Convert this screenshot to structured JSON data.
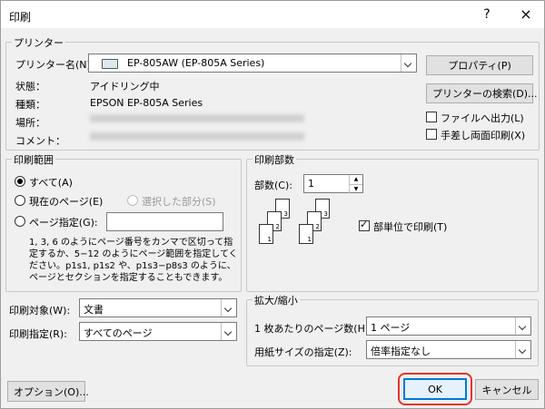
{
  "window": {
    "title": "印刷",
    "help": "?",
    "close": "×"
  },
  "printer": {
    "group_label": "プリンター",
    "name_label": "プリンター名(N):",
    "name_value": "EP-805AW (EP-805A Series)",
    "status_label": "状態：",
    "status_value": "アイドリング中",
    "type_label": "種類：",
    "type_value": "EPSON EP-805A Series",
    "location_label": "場所：",
    "comment_label": "コメント：",
    "properties_button": "プロパティ(P)",
    "find_button": "プリンターの検索(D)...",
    "print_to_file": "ファイルへ出力(L)",
    "manual_duplex": "手差し両面印刷(X)"
  },
  "range": {
    "group_label": "印刷範囲",
    "all": "すべて(A)",
    "current": "現在のページ(E)",
    "selection": "選択した部分(S)",
    "pages": "ページ指定(G):",
    "pages_value": "",
    "help_lines": [
      "1, 3, 6 のようにページ番号をカンマで区切って指",
      "定するか、5−12 のようにページ範囲を指定してく",
      "ださい。p1s1, p1s2 や、p1s3−p8s3 のように、",
      "ページとセクションを指定することもできます。"
    ]
  },
  "copies": {
    "group_label": "印刷部数",
    "count_label": "部数(C):",
    "count_value": "1",
    "collate": "部単位で印刷(T)",
    "page_digits": [
      "3",
      "2",
      "1",
      "3",
      "2",
      "1"
    ]
  },
  "print_what": {
    "label": "印刷対象(W):",
    "value": "文書"
  },
  "print_mode": {
    "label": "印刷指定(R):",
    "value": "すべてのページ"
  },
  "zoom": {
    "group_label": "拡大/縮小",
    "pages_per_sheet_label": "1 枚あたりのページ数(H):",
    "pages_per_sheet_value": "1 ページ",
    "scale_label": "用紙サイズの指定(Z):",
    "scale_value": "倍率指定なし"
  },
  "footer": {
    "options": "オプション(O)...",
    "ok": "OK",
    "cancel": "キャンセル"
  },
  "colors": {
    "highlight": "#e0352b",
    "default_border": "#0078d7"
  }
}
